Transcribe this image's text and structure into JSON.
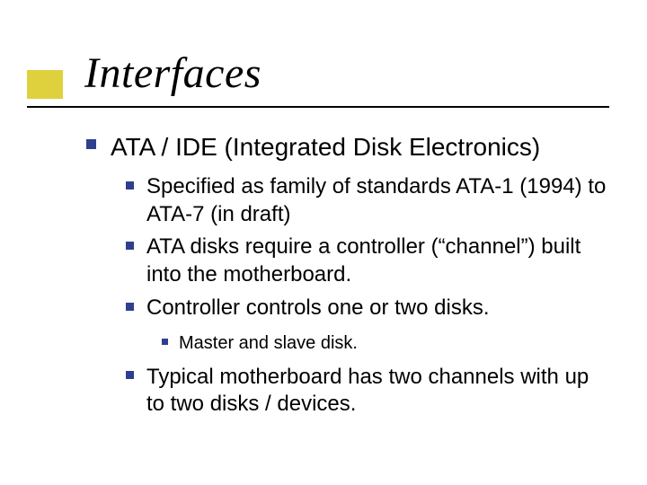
{
  "title": "Interfaces",
  "lvl1": {
    "text": "ATA / IDE (Integrated Disk Electronics)"
  },
  "lvl2": {
    "a": "Specified as family of standards ATA-1 (1994) to ATA-7 (in draft)",
    "b": "ATA disks require a controller (“channel”) built into the motherboard.",
    "c": "Controller controls one or two disks.",
    "d": "Typical motherboard has two channels with up to two disks / devices."
  },
  "lvl3": {
    "a": "Master and slave disk."
  }
}
